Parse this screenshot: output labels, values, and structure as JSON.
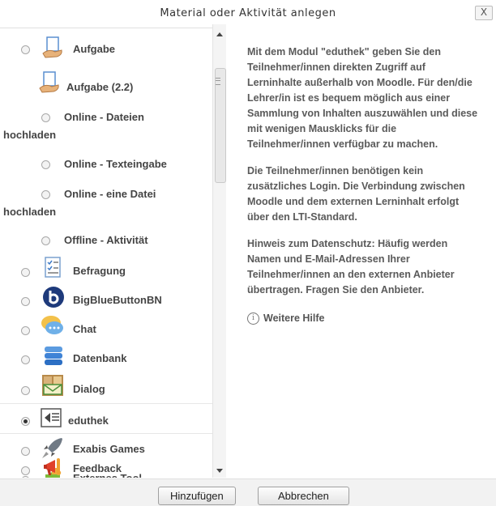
{
  "dialog": {
    "title": "Material oder Aktivität anlegen",
    "ghost_title": "Material oder Aktivität anlegen",
    "close_label": "X"
  },
  "modules": [
    {
      "label": "Aufgabe",
      "icon": "assignment-icon",
      "selected": false
    },
    {
      "label": "Aufgabe (2.2)",
      "icon": "assignment-icon",
      "selected": false
    },
    {
      "label": "Online - Dateien hochladen",
      "selected": false
    },
    {
      "label": "Online - Texteingabe",
      "selected": false
    },
    {
      "label": "Online - eine Datei hochladen",
      "selected": false
    },
    {
      "label": "Offline - Aktivität",
      "selected": false
    },
    {
      "label": "Befragung",
      "icon": "survey-icon",
      "selected": false
    },
    {
      "label": "BigBlueButtonBN",
      "icon": "bigbluebutton-icon",
      "selected": false
    },
    {
      "label": "Chat",
      "icon": "chat-icon",
      "selected": false
    },
    {
      "label": "Datenbank",
      "icon": "database-icon",
      "selected": false
    },
    {
      "label": "Dialog",
      "icon": "dialog-icon",
      "selected": false
    },
    {
      "label": "eduthek",
      "icon": "eduthek-icon",
      "selected": true
    },
    {
      "label": "Exabis Games",
      "icon": "rocket-icon",
      "selected": false
    },
    {
      "label": "Externes Tool",
      "icon": "puzzle-icon",
      "selected": false
    },
    {
      "label": "Feedback",
      "icon": "megaphone-icon",
      "selected": false
    }
  ],
  "description": {
    "paragraphs": [
      "Mit dem Modul \"eduthek\" geben Sie den Teilnehmer/innen direkten Zugriff auf Lerninhalte außerhalb von Moodle. Für den/die Lehrer/in ist es bequem möglich aus einer Sammlung von Inhalten auszuwählen und diese mit wenigen Mausklicks für die Teilnehmer/innen verfügbar zu machen.",
      "Die Teilnehmer/innen benötigen kein zusätzliches Login. Die Verbindung zwischen Moodle und dem externen Lerninhalt erfolgt über den LTI-Standard.",
      "Hinweis zum Datenschutz: Häufig werden Namen und E-Mail-Adressen Ihrer Teilnehmer/innen an den externen Anbieter übertragen. Fragen Sie den Anbieter."
    ],
    "help_link": "Weitere Hilfe",
    "help_icon": "info-icon"
  },
  "footer": {
    "add_label": "Hinzufügen",
    "cancel_label": "Abbrechen"
  },
  "colors": {
    "text": "#444444",
    "footer_bg": "#f2f2f2"
  }
}
